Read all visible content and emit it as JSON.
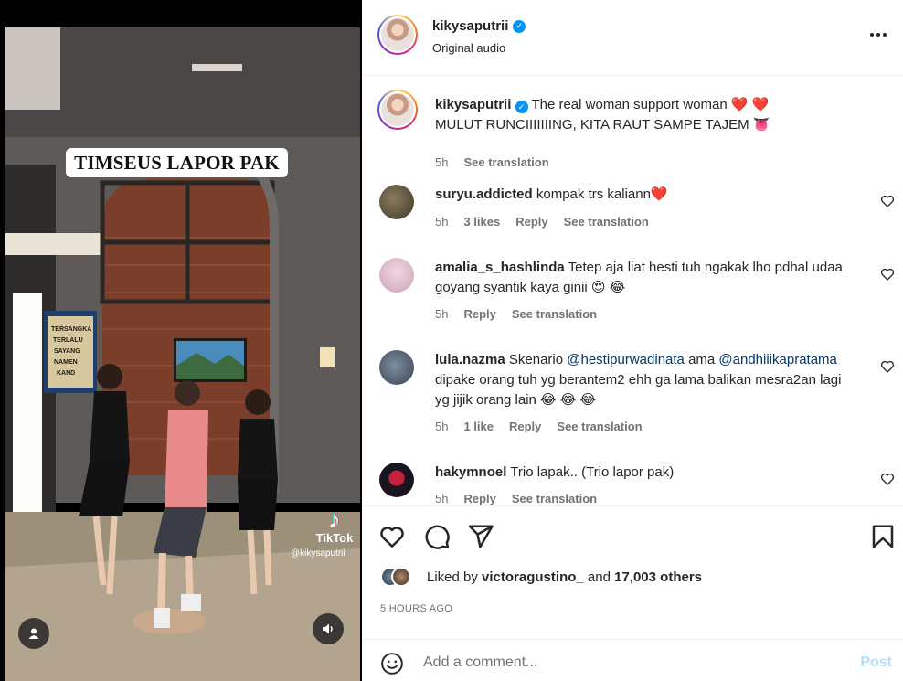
{
  "media": {
    "overlay_title": "TIMSEUS LAPOR PAK",
    "wall_sign": [
      "TERSANGKA",
      "TERLALU",
      "SAYANG",
      "NAMEN",
      "KAND"
    ],
    "watermark_brand": "TikTok",
    "watermark_user": "@kikysaputrii",
    "icons": [
      "user-tag-icon",
      "speaker-icon",
      "tiktok-icon"
    ]
  },
  "header": {
    "username": "kikysaputrii",
    "subtitle": "Original audio",
    "more_icon": "ellipsis-icon"
  },
  "caption": {
    "username": "kikysaputrii",
    "text_line1": "The real woman support woman",
    "emoji_line1": "❤️ ❤️",
    "text_line2": "MULUT RUNCIIIIIIING, KITA RAUT SAMPE TAJEM",
    "emoji_line2": "👅",
    "time": "5h",
    "translate": "See translation"
  },
  "comments": [
    {
      "username": "suryu.addicted",
      "text": "kompak trs kaliann❤️",
      "time": "5h",
      "likes": "3 likes",
      "reply": "Reply",
      "translate": "See translation"
    },
    {
      "username": "amalia_s_hashlinda",
      "text": "Tetep aja liat hesti tuh ngakak lho pdhal udaa goyang syantik kaya ginii 😍 😂",
      "time": "5h",
      "reply": "Reply",
      "translate": "See translation"
    },
    {
      "username": "lula.nazma",
      "text_pre": "Skenario",
      "mention1": "@hestipurwadinata",
      "text_mid": "ama",
      "mention2": "@andhiiikapratama",
      "text_post": "dipake orang tuh yg berantem2 ehh ga lama balikan mesra2an lagi yg jijik orang lain 😂 😂 😂",
      "time": "5h",
      "likes": "1 like",
      "reply": "Reply",
      "translate": "See translation"
    },
    {
      "username": "hakymnoel",
      "text": "Trio lapak.. (Trio lapor pak)",
      "time": "5h",
      "reply": "Reply",
      "translate": "See translation"
    }
  ],
  "actions": {
    "icons": [
      "heart-icon",
      "comment-icon",
      "share-icon",
      "bookmark-icon"
    ],
    "liked_by_label": "Liked by",
    "liked_by_user": "victoragustino_",
    "and_label": "and",
    "others": "17,003 others",
    "timestamp": "5 HOURS AGO"
  },
  "composer": {
    "placeholder": "Add a comment...",
    "post_label": "Post"
  },
  "colors": {
    "accent": "#0095f6",
    "mention": "#00376b",
    "muted": "#737373",
    "post_disabled": "#b2dffc",
    "like_red": "#ed4956"
  }
}
